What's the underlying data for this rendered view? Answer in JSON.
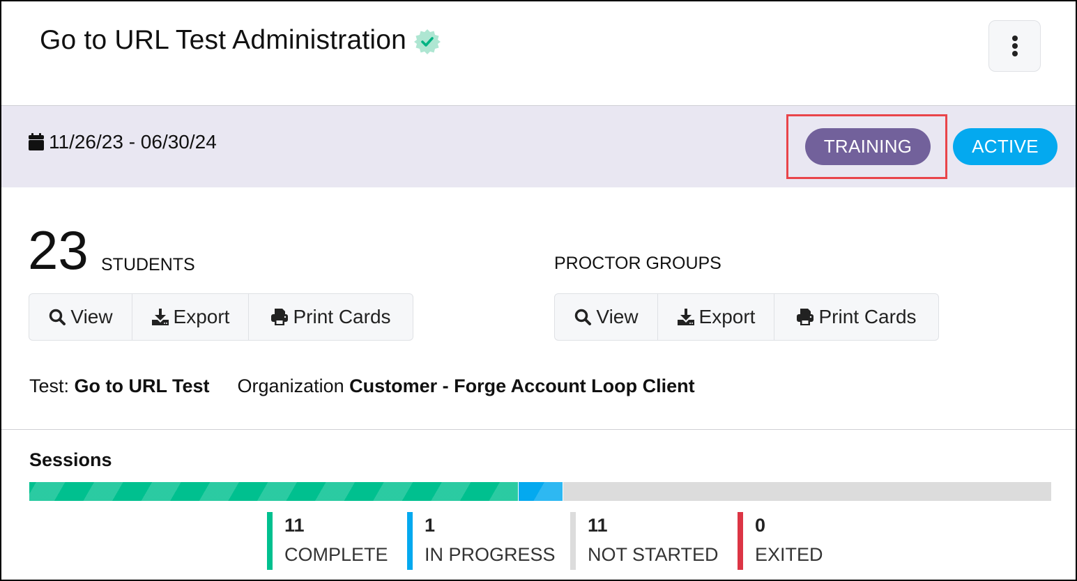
{
  "header": {
    "title": "Go to URL Test Administration",
    "verified_icon": "verified-badge-icon",
    "menu_icon": "kebab-menu-icon"
  },
  "band": {
    "date_icon": "calendar-icon",
    "date_range": "11/26/23 - 06/30/24",
    "badges": [
      {
        "label": "TRAINING",
        "color": "#72619b",
        "highlighted": true
      },
      {
        "label": "ACTIVE",
        "color": "#04a9ef"
      }
    ]
  },
  "students": {
    "count": "23",
    "label": "STUDENTS",
    "buttons": [
      {
        "label": "View",
        "icon": "search-icon"
      },
      {
        "label": "Export",
        "icon": "download-icon"
      },
      {
        "label": "Print Cards",
        "icon": "printer-icon"
      }
    ]
  },
  "proctor_groups": {
    "label": "PROCTOR GROUPS",
    "buttons": [
      {
        "label": "View",
        "icon": "search-icon"
      },
      {
        "label": "Export",
        "icon": "download-icon"
      },
      {
        "label": "Print Cards",
        "icon": "printer-icon"
      }
    ]
  },
  "meta": {
    "test_label": "Test:",
    "test_value": "Go to URL Test",
    "org_label": "Organization",
    "org_value": "Customer - Forge Account Loop Client"
  },
  "sessions": {
    "title": "Sessions",
    "total": 23,
    "statuses": [
      {
        "count": "11",
        "value": 11,
        "label": "COMPLETE",
        "color": "#00c08f"
      },
      {
        "count": "1",
        "value": 1,
        "label": "IN PROGRESS",
        "color": "#04a9ef"
      },
      {
        "count": "11",
        "value": 11,
        "label": "NOT STARTED",
        "color": "#dcdcdc"
      },
      {
        "count": "0",
        "value": 0,
        "label": "EXITED",
        "color": "#dc3545"
      }
    ]
  }
}
